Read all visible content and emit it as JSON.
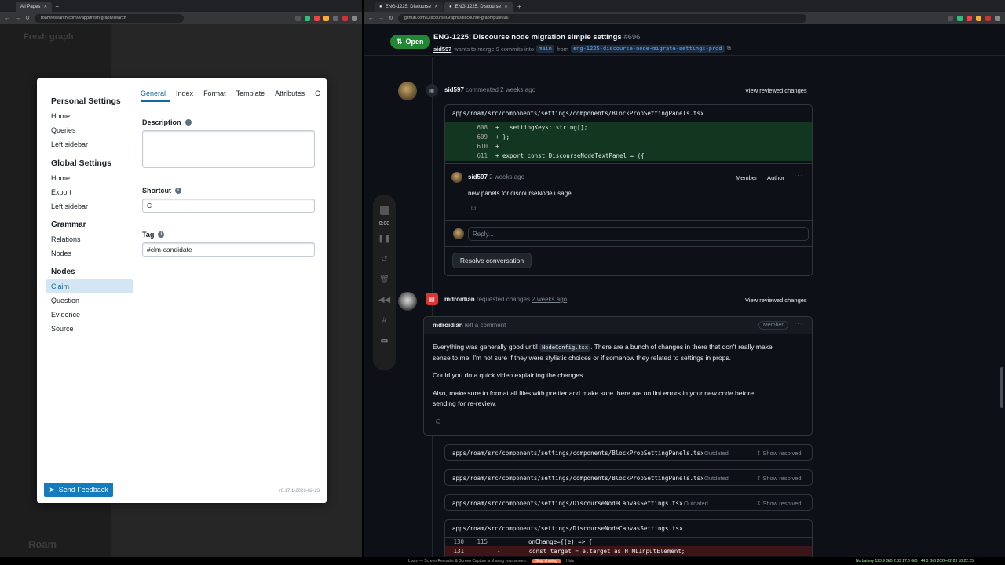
{
  "left_browser": {
    "tab_title": "All Pages",
    "url": "roamresearch.com/#/app/fresh-graph/search"
  },
  "roam_bg": {
    "ghost_title": "Fresh graph",
    "ghost_logo": "Roam"
  },
  "settings_modal": {
    "groups": [
      {
        "title": "Personal Settings",
        "items": [
          "Home",
          "Queries",
          "Left sidebar"
        ]
      },
      {
        "title": "Global Settings",
        "items": [
          "Home",
          "Export",
          "Left sidebar"
        ]
      },
      {
        "title": "Grammar",
        "items": [
          "Relations",
          "Nodes"
        ]
      },
      {
        "title": "Nodes",
        "items": [
          "Claim",
          "Question",
          "Evidence",
          "Source"
        ]
      }
    ],
    "active_item": "Claim",
    "tabs": [
      "General",
      "Index",
      "Format",
      "Template",
      "Attributes",
      "C"
    ],
    "active_tab": "General",
    "fields": {
      "description": {
        "label": "Description",
        "value": ""
      },
      "shortcut": {
        "label": "Shortcut",
        "value": "C"
      },
      "tag": {
        "label": "Tag",
        "value": "#clm-candidate"
      }
    },
    "feedback_label": "Send Feedback",
    "version": "v0.17.1-2026-02-23"
  },
  "recorder": {
    "time": "0:00"
  },
  "right_browser": {
    "tab1": "ENG-1225: Discourse",
    "tab2": "ENG-1225: Discourse",
    "url": "github.com/DiscourseGraphs/discourse-graph/pull/696"
  },
  "pr_header": {
    "status": "Open",
    "title": "ENG-1225: Discourse node migration simple settings",
    "number": "#696",
    "author": "sid597",
    "merge_text": "wants to merge 9 commits into",
    "base": "main",
    "from": "from",
    "head": "eng-1225-discourse-node-migrate-settings-prod"
  },
  "timeline": {
    "event1": {
      "author": "sid597",
      "action": "commented",
      "time": "2 weeks ago",
      "view": "View reviewed changes",
      "file": "apps/roam/src/components/settings/components/BlockPropSettingPanels.tsx",
      "diff": [
        {
          "n": "608",
          "code": "+   settingKeys: string[];"
        },
        {
          "n": "609",
          "code": "+ };"
        },
        {
          "n": "610",
          "code": "+"
        },
        {
          "n": "611",
          "code": "+ export const DiscourseNodeTextPanel = ({"
        }
      ],
      "comment_author": "sid597",
      "comment_time": "2 weeks ago",
      "badge_member": "Member",
      "badge_author": "Author",
      "comment_body": "new panels for discourseNode usage",
      "reply_placeholder": "Reply...",
      "resolve": "Resolve conversation"
    },
    "event2": {
      "author": "mdroidian",
      "action": "requested changes",
      "time": "2 weeks ago",
      "view": "View reviewed changes",
      "comment_author": "mdroidian",
      "comment_action": "left a comment",
      "badge_member": "Member",
      "p1_a": "Everything was generally good until ",
      "p1_code": "NodeConfig.tsx",
      "p1_b": ". There are a bunch of changes in there that don't really make",
      "p1_c": "sense to me. I'm not sure if they were stylistic choices or if somehow they related to settings in props.",
      "p2": "Could you do a quick video explaining the changes.",
      "p3_a": "Also, make sure to format all files with prettier and make sure there are no lint errors in your new code before",
      "p3_b": "sending for re-review."
    },
    "resolved_files": [
      {
        "path": "apps/roam/src/components/settings/components/BlockPropSettingPanels.tsx",
        "tag": "Outdated",
        "action": "Show resolved"
      },
      {
        "path": "apps/roam/src/components/settings/components/BlockPropSettingPanels.tsx",
        "tag": "Outdated",
        "action": "Show resolved"
      },
      {
        "path": "apps/roam/src/components/settings/DiscourseNodeCanvasSettings.tsx",
        "tag": "Outdated",
        "action": "Show resolved"
      }
    ],
    "last_file": {
      "path": "apps/roam/src/components/settings/DiscourseNodeCanvasSettings.tsx",
      "rows": [
        {
          "a": "130",
          "b": "115",
          "code": "onChange={(e) => {"
        },
        {
          "a": "131",
          "b": "",
          "code": "-        const target = e.target as HTMLInputElement;"
        }
      ]
    }
  },
  "taskbar": {
    "loom_text": "Loom — Screen Recorder & Screen Capture is sharing your screen.",
    "stop_label": "Stop sharing",
    "hide_label": "Hide",
    "status_text": "No battery 123.9 GiB 2.39 17.6 GiB | 44.3 GiB 2026-02-23 18:22:25"
  },
  "colors": {
    "gh_bg": "#0d1117",
    "gh_green": "#238636",
    "roam_blue": "#137cbd",
    "diff_add": "#12361f",
    "diff_del": "#3d1517",
    "request_red": "#da3633"
  }
}
